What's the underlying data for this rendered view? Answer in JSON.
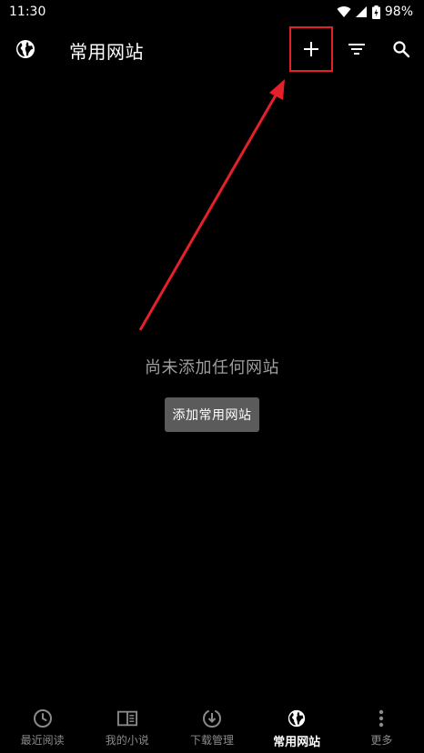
{
  "status_bar": {
    "time": "11:30",
    "battery": "98%"
  },
  "app_bar": {
    "title": "常用网站",
    "nav_icon": "globe-icon",
    "actions": [
      "add-icon",
      "filter-icon",
      "search-icon"
    ]
  },
  "empty_state": {
    "message": "尚未添加任何网站",
    "button_label": "添加常用网站"
  },
  "bottom_nav": {
    "items": [
      {
        "label": "最近阅读",
        "icon": "clock-icon",
        "active": false
      },
      {
        "label": "我的小说",
        "icon": "book-icon",
        "active": false
      },
      {
        "label": "下载管理",
        "icon": "download-icon",
        "active": false
      },
      {
        "label": "常用网站",
        "icon": "globe-icon",
        "active": true
      },
      {
        "label": "更多",
        "icon": "more-vertical-icon",
        "active": false
      }
    ]
  },
  "colors": {
    "background": "#000000",
    "annotation": "#e5202a",
    "button_bg": "#5b5b5b",
    "muted_text": "#9e9e9e",
    "nav_inactive": "#8a8a8a"
  }
}
